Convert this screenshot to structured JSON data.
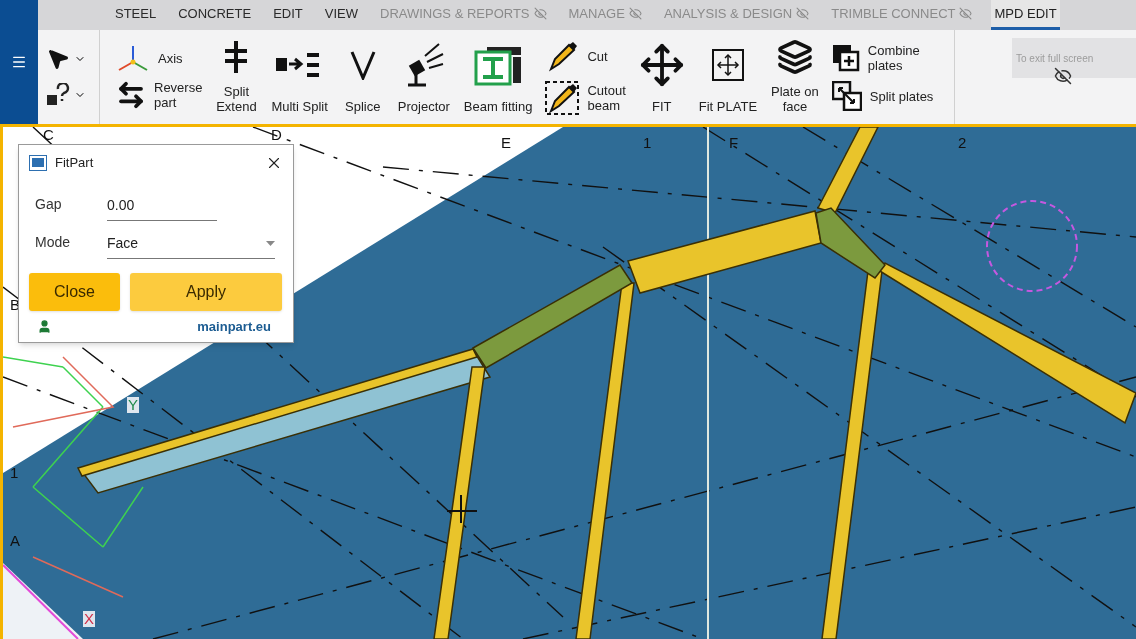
{
  "menu_tabs": [
    {
      "label": "STEEL",
      "hidden": false,
      "selected": false
    },
    {
      "label": "CONCRETE",
      "hidden": false,
      "selected": false
    },
    {
      "label": "EDIT",
      "hidden": false,
      "selected": false
    },
    {
      "label": "VIEW",
      "hidden": false,
      "selected": false
    },
    {
      "label": "DRAWINGS & REPORTS",
      "hidden": true,
      "selected": false
    },
    {
      "label": "MANAGE",
      "hidden": true,
      "selected": false
    },
    {
      "label": "ANALYSIS & DESIGN",
      "hidden": true,
      "selected": false
    },
    {
      "label": "TRIMBLE CONNECT",
      "hidden": true,
      "selected": false
    },
    {
      "label": "MPD EDIT",
      "hidden": false,
      "selected": true
    }
  ],
  "ribbon": [
    {
      "kind": "stack",
      "items": [
        "Axis",
        "Reverse\npart"
      ]
    },
    {
      "kind": "large",
      "label": "Split\nExtend"
    },
    {
      "kind": "large",
      "label": "Multi Split"
    },
    {
      "kind": "large",
      "label": "Splice"
    },
    {
      "kind": "large",
      "label": "Projector"
    },
    {
      "kind": "large",
      "label": "Beam fitting"
    },
    {
      "kind": "stack",
      "items": [
        "Cut",
        "Cutout\nbeam"
      ]
    },
    {
      "kind": "large",
      "label": "FIT"
    },
    {
      "kind": "large",
      "label": "Fit PLATE"
    },
    {
      "kind": "large",
      "label": "Plate on\nface"
    },
    {
      "kind": "stack",
      "items": [
        "Combine\nplates",
        "Split plates"
      ]
    }
  ],
  "fullscreen_notice": "To exit full screen",
  "grid_labels": [
    "C",
    "D",
    "E",
    "1",
    "F",
    "2",
    "B",
    "1",
    "A",
    "Y",
    "X"
  ],
  "dialog": {
    "title": "FitPart",
    "fields": [
      {
        "kind": "text",
        "label": "Gap",
        "value": "0.00"
      },
      {
        "kind": "select",
        "label": "Mode",
        "value": "Face"
      }
    ],
    "buttons": [
      "Close",
      "Apply"
    ],
    "link": "mainpart.eu"
  }
}
